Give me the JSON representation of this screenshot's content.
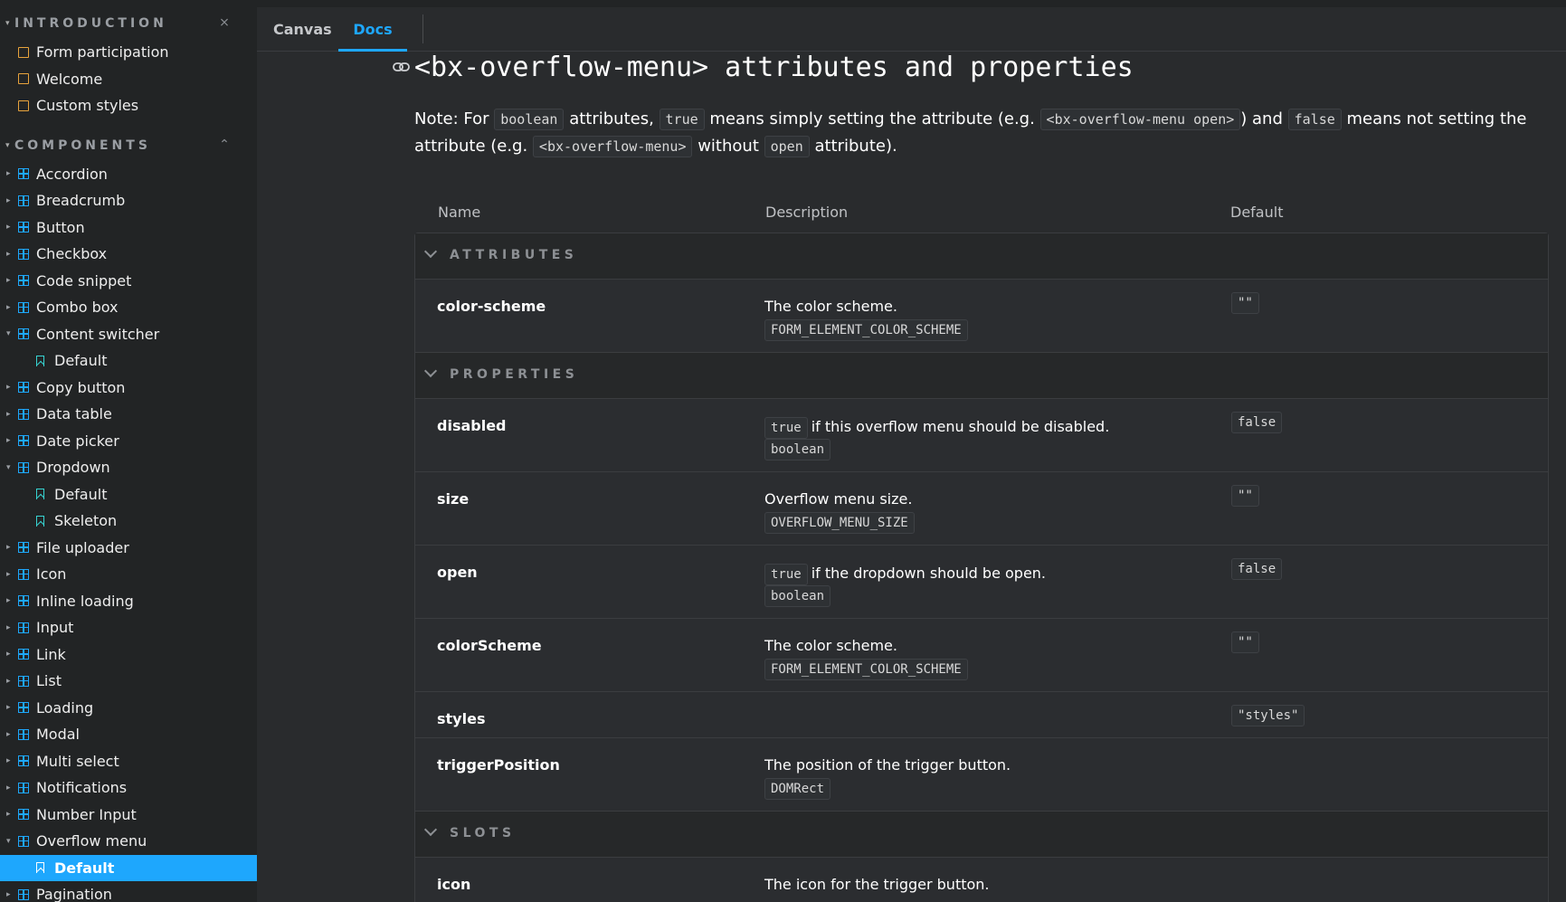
{
  "sidebar": {
    "introduction": {
      "title": "INTRODUCTION",
      "items": [
        {
          "label": "Form participation"
        },
        {
          "label": "Welcome"
        },
        {
          "label": "Custom styles"
        }
      ]
    },
    "components": {
      "title": "COMPONENTS",
      "items": [
        {
          "label": "Accordion"
        },
        {
          "label": "Breadcrumb"
        },
        {
          "label": "Button"
        },
        {
          "label": "Checkbox"
        },
        {
          "label": "Code snippet"
        },
        {
          "label": "Combo box"
        },
        {
          "label": "Content switcher"
        },
        {
          "label": "Default"
        },
        {
          "label": "Copy button"
        },
        {
          "label": "Data table"
        },
        {
          "label": "Date picker"
        },
        {
          "label": "Dropdown"
        },
        {
          "label": "Default"
        },
        {
          "label": "Skeleton"
        },
        {
          "label": "File uploader"
        },
        {
          "label": "Icon"
        },
        {
          "label": "Inline loading"
        },
        {
          "label": "Input"
        },
        {
          "label": "Link"
        },
        {
          "label": "List"
        },
        {
          "label": "Loading"
        },
        {
          "label": "Modal"
        },
        {
          "label": "Multi select"
        },
        {
          "label": "Notifications"
        },
        {
          "label": "Number Input"
        },
        {
          "label": "Overflow menu"
        },
        {
          "label": "Default"
        },
        {
          "label": "Pagination"
        }
      ]
    }
  },
  "tabs": {
    "canvas": "Canvas",
    "docs": "Docs"
  },
  "doc": {
    "title": "<bx-overflow-menu> attributes and properties",
    "note": {
      "p1": "Note: For ",
      "c1": "boolean",
      "p2": " attributes, ",
      "c2": "true",
      "p3": " means simply setting the attribute (e.g. ",
      "c3": "<bx-overflow-menu open>",
      "p4": ") and ",
      "c4": "false",
      "p5": " means not setting the attribute (e.g. ",
      "c5": "<bx-overflow-menu>",
      "p6": " without ",
      "c6": "open",
      "p7": " attribute)."
    },
    "columns": {
      "name": "Name",
      "description": "Description",
      "default": "Default"
    },
    "groups": {
      "attributes": "ATTRIBUTES",
      "properties": "PROPERTIES",
      "slots": "SLOTS"
    },
    "rows": {
      "color_scheme_attr": {
        "name": "color-scheme",
        "desc": "The color scheme.",
        "type": "FORM_ELEMENT_COLOR_SCHEME",
        "default": "\"\""
      },
      "disabled": {
        "name": "disabled",
        "desc_code": "true",
        "desc": "if this overflow menu should be disabled.",
        "type": "boolean",
        "default": "false"
      },
      "size": {
        "name": "size",
        "desc": "Overflow menu size.",
        "type": "OVERFLOW_MENU_SIZE",
        "default": "\"\""
      },
      "open": {
        "name": "open",
        "desc_code": "true",
        "desc": "if the dropdown should be open.",
        "type": "boolean",
        "default": "false"
      },
      "colorScheme": {
        "name": "colorScheme",
        "desc": "The color scheme.",
        "type": "FORM_ELEMENT_COLOR_SCHEME",
        "default": "\"\""
      },
      "styles": {
        "name": "styles",
        "default": "\"styles\""
      },
      "triggerPosition": {
        "name": "triggerPosition",
        "desc": "The position of the trigger button.",
        "type": "DOMRect"
      },
      "icon": {
        "name": "icon",
        "desc": "The icon for the trigger button."
      }
    }
  }
}
